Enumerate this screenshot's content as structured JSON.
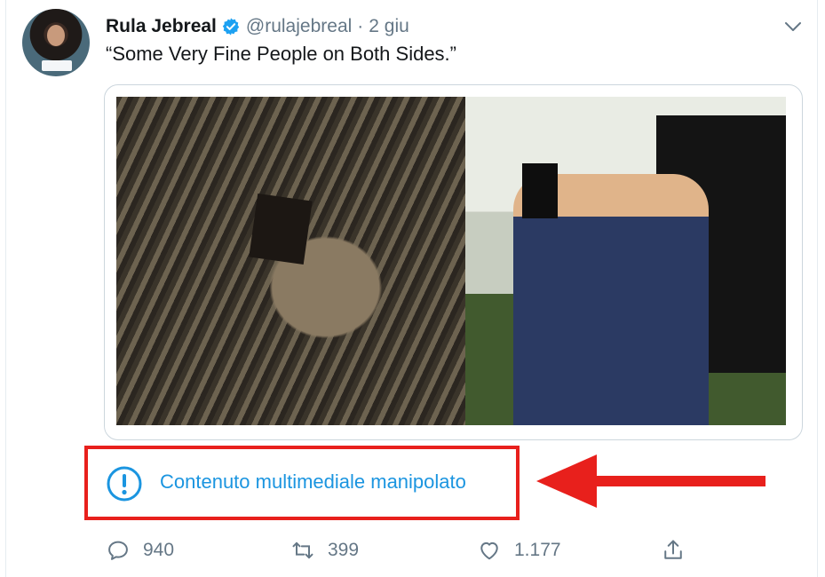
{
  "tweet": {
    "author_name": "Rula Jebreal",
    "handle": "@rulajebreal",
    "separator": "·",
    "date": "2 giu",
    "text": "“Some Very Fine People on Both Sides.”"
  },
  "media_notice": {
    "icon": "exclamation-circle-icon",
    "label": "Contenuto multimediale manipolato",
    "highlight_color": "#e8201c",
    "link_color": "#1b95e0"
  },
  "actions": {
    "reply_count": "940",
    "retweet_count": "399",
    "like_count": "1.177"
  },
  "colors": {
    "verified": "#1da1f2",
    "muted_text": "#657786",
    "border": "#ccd6dd"
  }
}
